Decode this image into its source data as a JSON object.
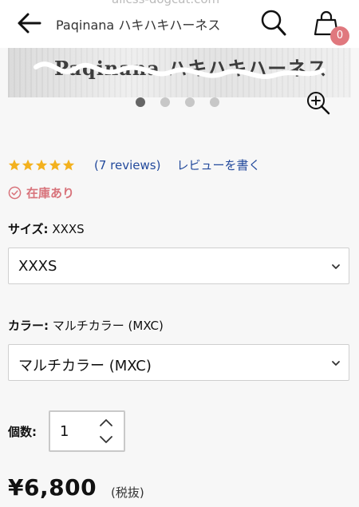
{
  "header": {
    "title": "Paqinana ハキハキハーネス",
    "top_cut_text": "allcss-dogcat.com",
    "cart_count": "0",
    "icons": {
      "back": "arrow-left-icon",
      "search": "search-icon",
      "cart": "shopping-bag-icon"
    }
  },
  "gallery": {
    "image_text": "Paqinana ハキハキハーネス",
    "slide_count": 4,
    "active_slide": 1,
    "zoom_icon": "zoom-in-icon"
  },
  "reviews": {
    "rating": 5,
    "count_text": "(7 reviews)",
    "write_review": "レビューを書く",
    "star_color": "#f3b11e"
  },
  "stock": {
    "text": "在庫あり",
    "color": "#d8737b"
  },
  "size": {
    "label": "サイズ:",
    "selected_text": "XXXS",
    "value": "XXXS"
  },
  "color": {
    "label": "カラー:",
    "selected_text": "マルチカラー (MXC)",
    "value": "マルチカラー (MXC)"
  },
  "quantity": {
    "label": "個数:",
    "value": "1"
  },
  "price": {
    "amount": "¥6,800",
    "tax_note": "(税抜)"
  },
  "colors": {
    "link": "#234a9c",
    "badge": "#e0787e"
  }
}
